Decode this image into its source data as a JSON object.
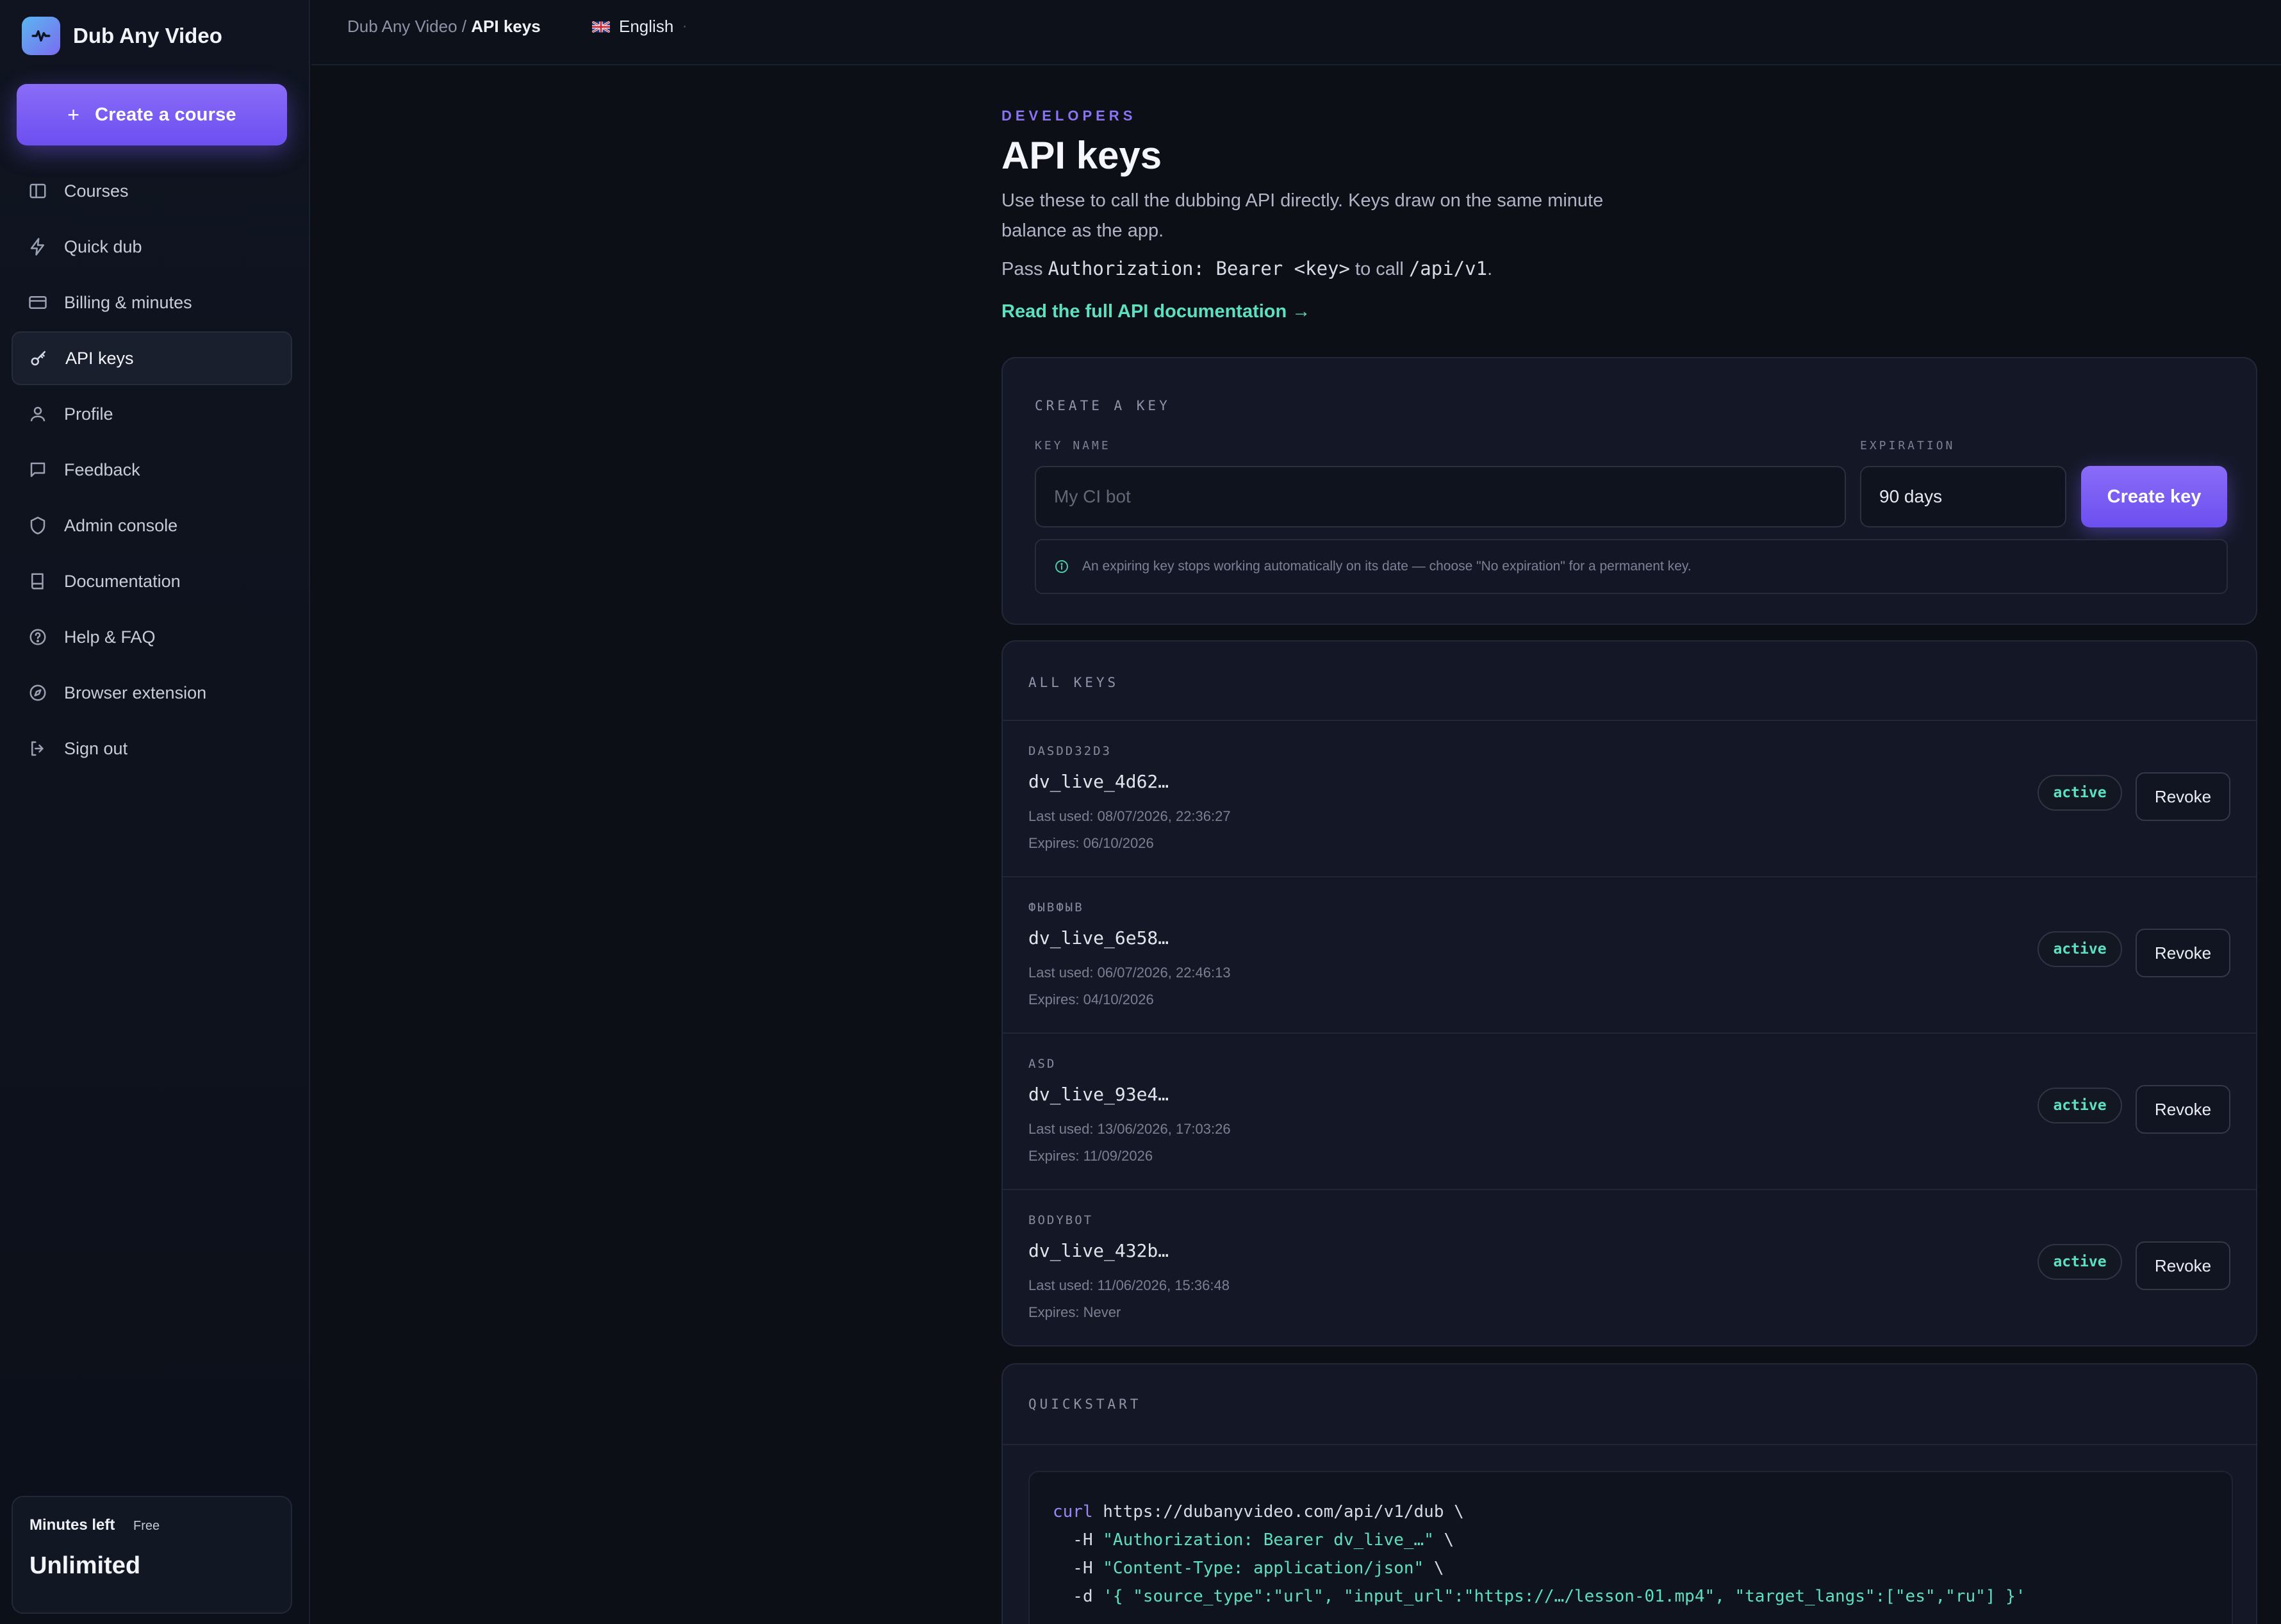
{
  "app": {
    "name": "Dub Any Video",
    "create_course_label": "Create a course"
  },
  "sidebar": {
    "items": [
      {
        "label": "Courses",
        "icon": "columns-icon"
      },
      {
        "label": "Quick dub",
        "icon": "lightning-icon"
      },
      {
        "label": "Billing & minutes",
        "icon": "credit-card-icon"
      },
      {
        "label": "API keys",
        "icon": "key-icon",
        "active": true
      },
      {
        "label": "Profile",
        "icon": "user-icon"
      },
      {
        "label": "Feedback",
        "icon": "message-icon"
      },
      {
        "label": "Admin console",
        "icon": "shield-icon"
      },
      {
        "label": "Documentation",
        "icon": "book-icon"
      },
      {
        "label": "Help & FAQ",
        "icon": "help-circle-icon"
      },
      {
        "label": "Browser extension",
        "icon": "compass-icon"
      },
      {
        "label": "Sign out",
        "icon": "sign-out-icon"
      }
    ],
    "minutes": {
      "label": "Minutes left",
      "plan": "Free",
      "value": "Unlimited"
    }
  },
  "topbar": {
    "breadcrumb_root": "Dub Any Video",
    "breadcrumb_sep": "/",
    "breadcrumb_current": "API keys",
    "language": "English"
  },
  "header": {
    "eyebrow": "DEVELOPERS",
    "title": "API keys",
    "description": "Use these to call the dubbing API directly. Keys draw on the same minute balance as the app.",
    "pass_prefix": "Pass",
    "pass_header": "Authorization: Bearer <key>",
    "pass_middle": "to call",
    "pass_endpoint": "/api/v1",
    "pass_suffix": ".",
    "doc_link": "Read the full API documentation →"
  },
  "create_key": {
    "section_label": "CREATE A KEY",
    "name_label": "KEY NAME",
    "name_placeholder": "My CI bot",
    "expiration_label": "EXPIRATION",
    "expiration_value": "90 days",
    "button": "Create key",
    "hint": "An expiring key stops working automatically on its date — choose \"No expiration\" for a permanent key."
  },
  "all_keys": {
    "section_label": "ALL KEYS",
    "keys": [
      {
        "name": "DASDD32D3",
        "prefix": "dv_live_4d62…",
        "last_used": "Last used: 08/07/2026, 22:36:27",
        "expires": "Expires: 06/10/2026",
        "status": "active",
        "action": "Revoke"
      },
      {
        "name": "ФЫВФЫВ",
        "prefix": "dv_live_6e58…",
        "last_used": "Last used: 06/07/2026, 22:46:13",
        "expires": "Expires: 04/10/2026",
        "status": "active",
        "action": "Revoke"
      },
      {
        "name": "ASD",
        "prefix": "dv_live_93e4…",
        "last_used": "Last used: 13/06/2026, 17:03:26",
        "expires": "Expires: 11/09/2026",
        "status": "active",
        "action": "Revoke"
      },
      {
        "name": "BODYBOT",
        "prefix": "dv_live_432b…",
        "last_used": "Last used: 11/06/2026, 15:36:48",
        "expires": "Expires: Never",
        "status": "active",
        "action": "Revoke"
      }
    ]
  },
  "quickstart": {
    "section_label": "QUICKSTART",
    "lines": [
      {
        "kw": "curl",
        "rest": " https://dubanyvideo.com/api/v1/dub \\"
      },
      {
        "pre": "  -H ",
        "str": "\"Authorization: Bearer dv_live_…\"",
        "post": " \\"
      },
      {
        "pre": "  -H ",
        "str": "\"Content-Type: application/json\"",
        "post": " \\"
      },
      {
        "pre": "  -d ",
        "str": "'{ \"source_type\":\"url\", \"input_url\":\"https://…/lesson-01.mp4\", \"target_langs\":[\"es\",\"ru\"] }'",
        "post": ""
      }
    ]
  },
  "colors": {
    "accent": "#7a5cf5",
    "link": "#5de0c0",
    "background": "#0d0f17",
    "card": "#141826"
  }
}
